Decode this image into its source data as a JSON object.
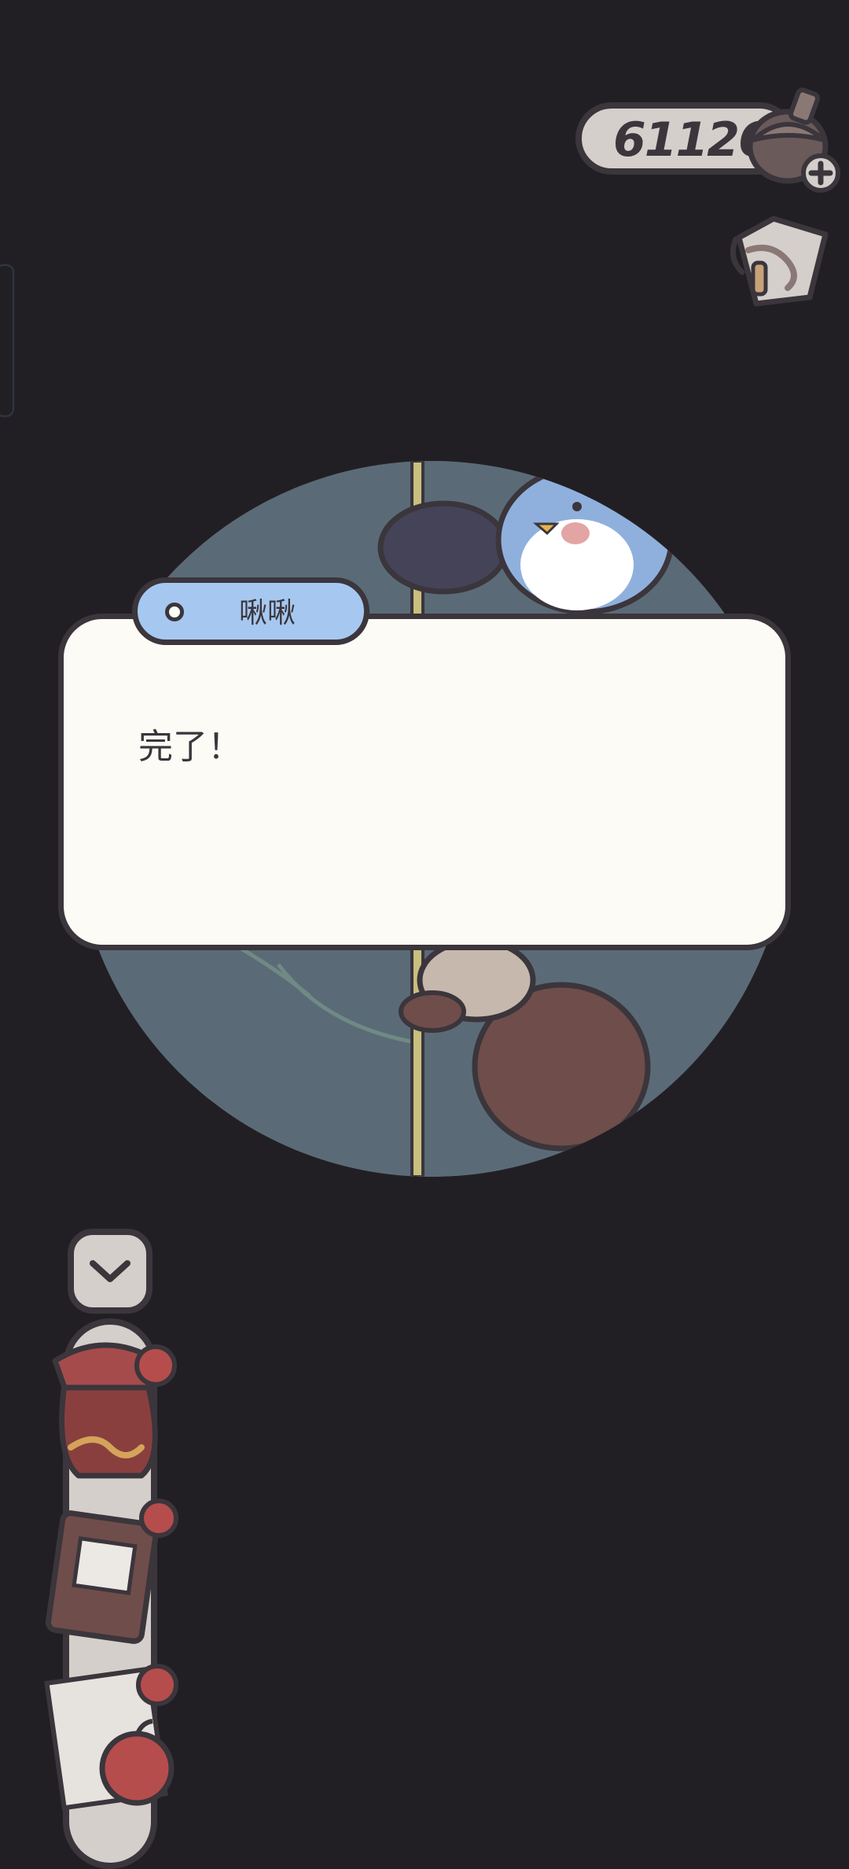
{
  "hud": {
    "currency_value": "61126",
    "currency_icon": "acorn-icon",
    "add_icon": "plus-icon",
    "map_icon": "map-icon"
  },
  "dialog": {
    "speaker": "啾啾",
    "text": "完了！"
  },
  "inventory": {
    "toggle_icon": "chevron-down-icon",
    "items": [
      {
        "icon": "pouch-icon"
      },
      {
        "icon": "book-icon"
      },
      {
        "icon": "note-apple-icon"
      }
    ]
  },
  "colors": {
    "background": "#221f24",
    "outline": "#3b353c",
    "dialog_bg": "#fdfbf5",
    "speaker_tab": "#a6c8f0",
    "scene": "#5a6b77"
  }
}
